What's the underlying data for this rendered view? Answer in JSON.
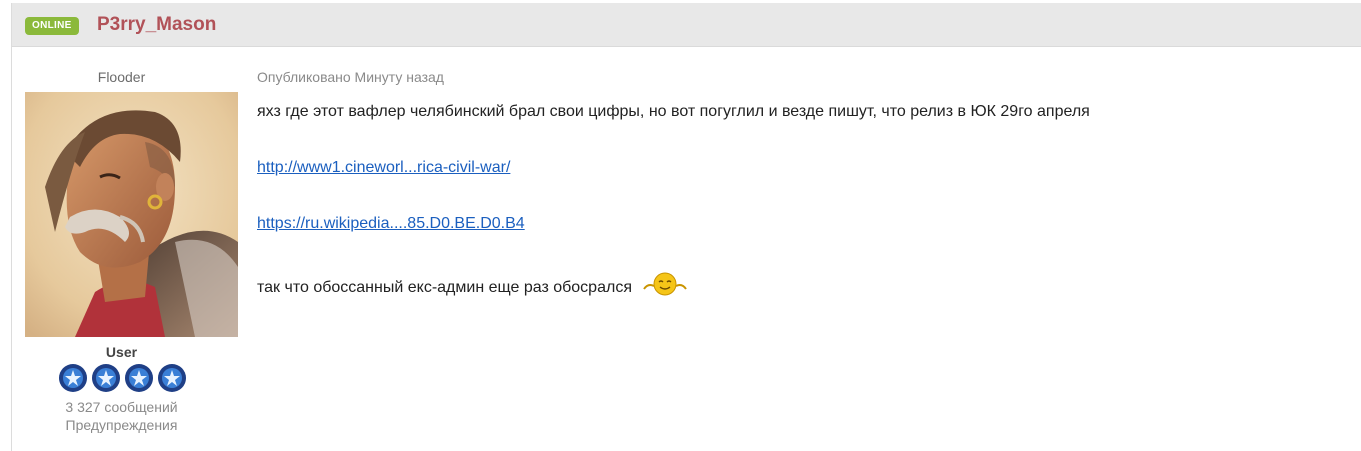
{
  "header": {
    "status_badge": "ONLINE",
    "username": "P3rry_Mason"
  },
  "author": {
    "title": "Flooder",
    "avatar_icon": "avatar-portrait",
    "group": "User",
    "rank_icons": [
      "rank-star-icon",
      "rank-star-icon",
      "rank-star-icon",
      "rank-star-icon"
    ],
    "post_count": "3 327 сообщений",
    "warnings_label": "Предупреждения"
  },
  "post": {
    "published": "Опубликовано Минуту назад",
    "line1": "яхз где этот вафлер челябинский брал свои цифры, но вот погуглил и везде пишут, что релиз в ЮК 29го апреля",
    "link1": "http://www1.cineworl...rica-civil-war/",
    "link2": "https://ru.wikipedia....85.D0.BE.D0.B4",
    "line2": "так что обоссанный екс-админ еще раз обосрался",
    "smiley_icon": "shy-smiley-icon"
  },
  "colors": {
    "header_bg": "#e8e8e8",
    "online_badge": "#8bb93b",
    "username": "#b15258",
    "link": "#1b5fbf"
  }
}
